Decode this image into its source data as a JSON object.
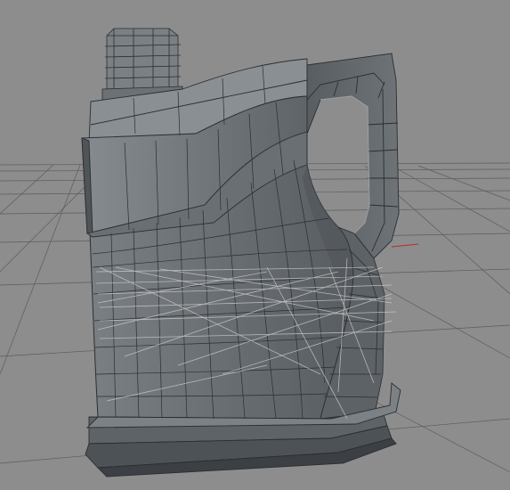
{
  "viewport": {
    "background": "#8d8d8d",
    "grid_color": "#5a5a5a",
    "x_axis_color": "#b03030",
    "mesh_fill": "#6f7478",
    "mesh_shade": "#4c5155",
    "mesh_light": "#9aa0a4",
    "wire_color": "#2b2e30",
    "construction_line_color": "#d4d4d4"
  },
  "object": {
    "kind": "jerry-can",
    "view": "perspective",
    "display": "gouraud-shading-with-wireframe"
  }
}
